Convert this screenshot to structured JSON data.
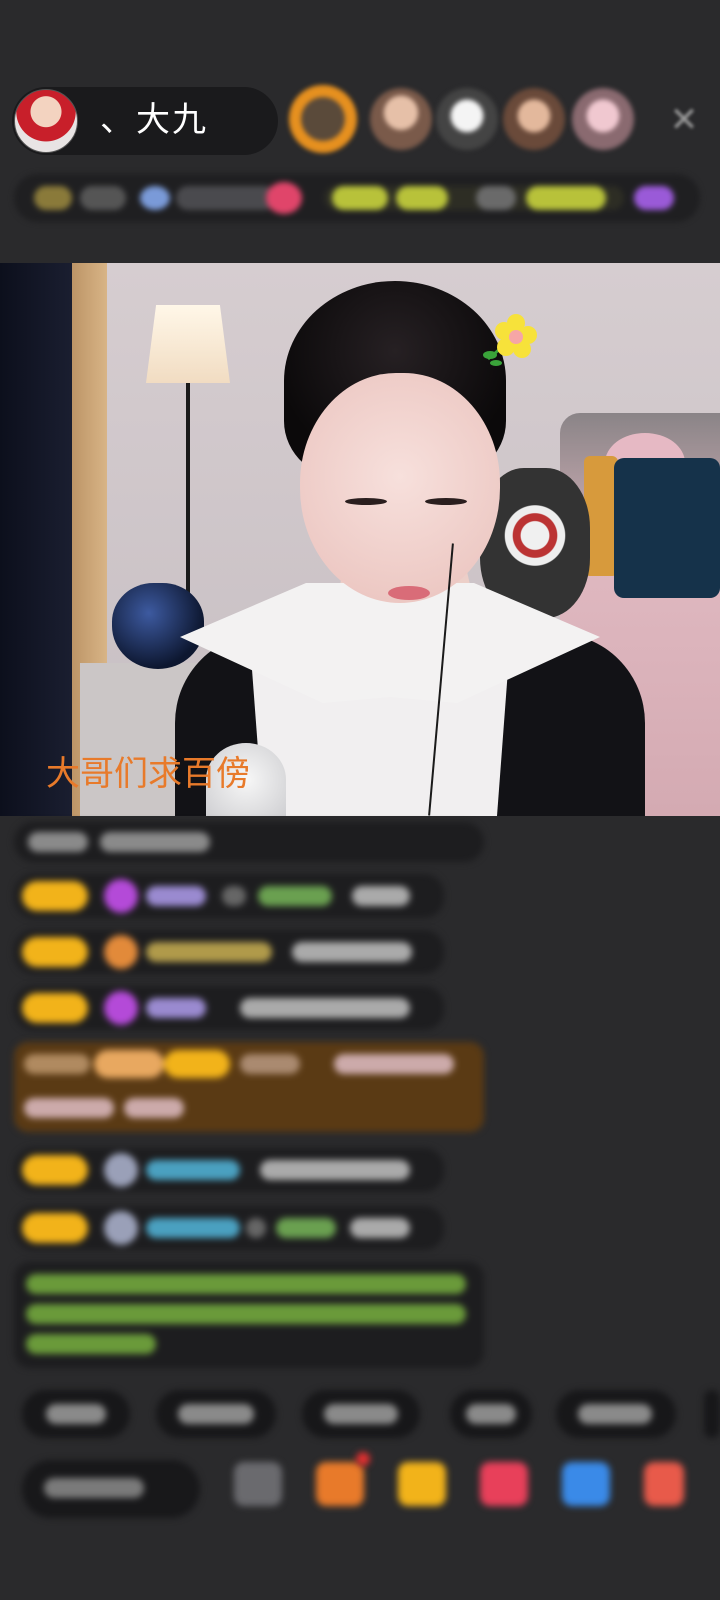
{
  "header": {
    "host_name": "、大九",
    "host_avatar_icon": "host-avatar",
    "viewer_avatars": [
      "viewer-avatar-1",
      "viewer-avatar-2",
      "viewer-avatar-3",
      "viewer-avatar-4",
      "viewer-avatar-5"
    ],
    "close_icon": "close-icon",
    "close_glyph": "✕"
  },
  "stream": {
    "overlay_text": "大哥们求百傍"
  },
  "colors": {
    "background": "#2a2a2c",
    "badge": "#f2b31a",
    "overlay_text": "#e87a2a",
    "highlight_row": "#5a3a14",
    "system_text": "#8ad24a"
  }
}
